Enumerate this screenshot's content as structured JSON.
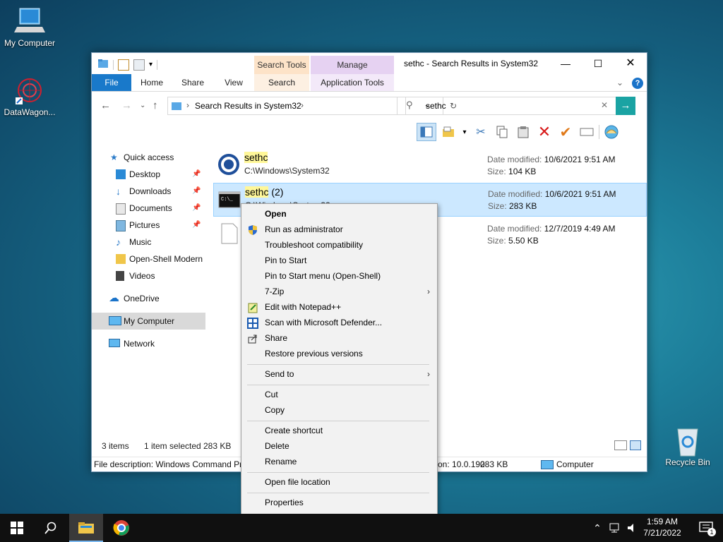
{
  "desktop": {
    "icons": [
      {
        "label": "My Computer"
      },
      {
        "label": "DataWagon..."
      },
      {
        "label": "Recycle Bin"
      }
    ]
  },
  "window": {
    "title": "sethc - Search Results in System32",
    "context_tabs": {
      "search_tools": "Search Tools",
      "manage": "Manage"
    },
    "tabs": [
      "File",
      "Home",
      "Share",
      "View",
      "Search",
      "Application Tools"
    ],
    "address": {
      "path": "Search Results in System32"
    },
    "search": {
      "value": "sethc"
    },
    "sidebar": [
      {
        "label": "Quick access"
      },
      {
        "label": "Desktop"
      },
      {
        "label": "Downloads"
      },
      {
        "label": "Documents"
      },
      {
        "label": "Pictures"
      },
      {
        "label": "Music"
      },
      {
        "label": "Open-Shell Modern"
      },
      {
        "label": "Videos"
      },
      {
        "label": "OneDrive"
      },
      {
        "label": "My Computer"
      },
      {
        "label": "Network"
      }
    ],
    "results": [
      {
        "name_hl": "sethc",
        "name_rest": "",
        "path": "C:\\Windows\\System32",
        "mod_label": "Date modified:",
        "modified": "10/6/2021 9:51 AM",
        "size_label": "Size:",
        "size": "104 KB"
      },
      {
        "name_hl": "sethc",
        "name_rest": " (2)",
        "path": "C:\\Windows\\System32",
        "mod_label": "Date modified:",
        "modified": "10/6/2021 9:51 AM",
        "size_label": "Size:",
        "size": "283 KB"
      },
      {
        "name_hl": "",
        "name_rest": "",
        "path": "",
        "mod_label": "Date modified:",
        "modified": "12/7/2019 4:49 AM",
        "size_label": "Size:",
        "size": "5.50 KB"
      }
    ],
    "status": {
      "items": "3 items",
      "selected": "1 item selected",
      "size": "283 KB"
    },
    "detail": {
      "description": "File description: Windows Command Pr",
      "version": "on: 10.0.190",
      "size": "283 KB",
      "location": "Computer"
    }
  },
  "context_menu": {
    "items": [
      "Open",
      "Run as administrator",
      "Troubleshoot compatibility",
      "Pin to Start",
      "Pin to Start menu (Open-Shell)",
      "7-Zip",
      "Edit with Notepad++",
      "Scan with Microsoft Defender...",
      "Share",
      "Restore previous versions",
      "Send to",
      "Cut",
      "Copy",
      "Create shortcut",
      "Delete",
      "Rename",
      "Open file location",
      "Properties"
    ]
  },
  "taskbar": {
    "time": "1:59 AM",
    "date": "7/21/2022",
    "notification_count": "1"
  }
}
